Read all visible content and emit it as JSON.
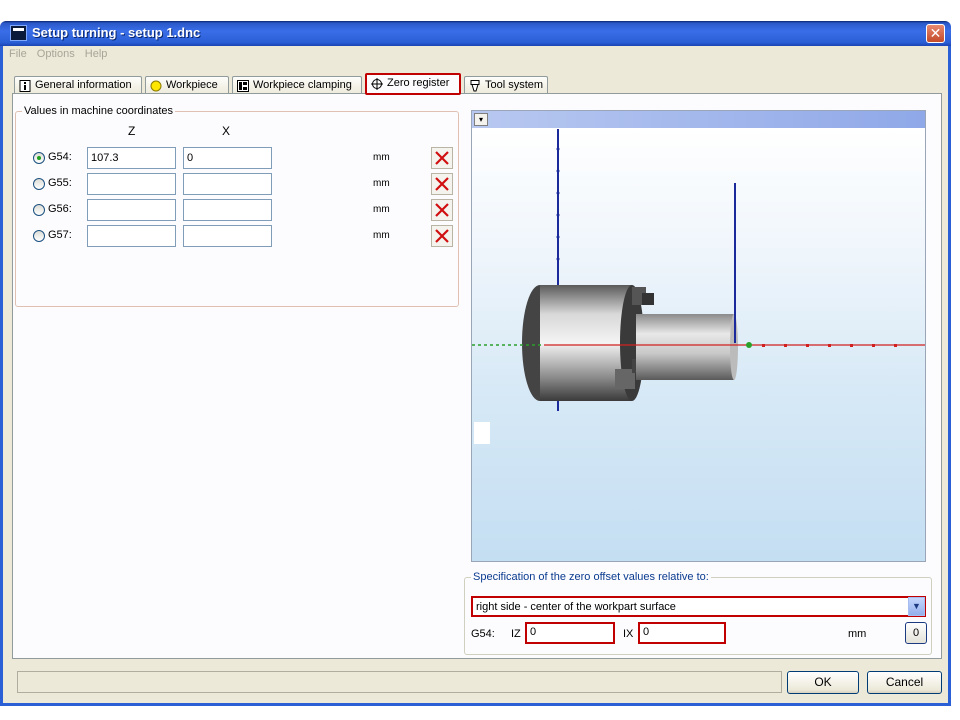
{
  "window": {
    "title": "Setup turning - setup 1.dnc",
    "close_glyph": "✕"
  },
  "menu": {
    "items": [
      "File",
      "Options",
      "Help"
    ]
  },
  "tabs": [
    {
      "label": "General information",
      "icon": "info-icon",
      "active": false
    },
    {
      "label": "Workpiece",
      "icon": "workpiece-circle-icon",
      "active": false
    },
    {
      "label": "Workpiece clamping",
      "icon": "clamping-icon",
      "active": false
    },
    {
      "label": "Zero register",
      "icon": "crosshair-icon",
      "active": true
    },
    {
      "label": "Tool system",
      "icon": "tool-holder-icon",
      "active": false
    }
  ],
  "coords": {
    "group_label": "Values in machine coordinates",
    "col_z": "Z",
    "col_x": "X",
    "unit": "mm",
    "rows": [
      {
        "label": "G54:",
        "z": "107.3",
        "x": "0",
        "selected": true
      },
      {
        "label": "G55:",
        "z": "",
        "x": "",
        "selected": false
      },
      {
        "label": "G56:",
        "z": "",
        "x": "",
        "selected": false
      },
      {
        "label": "G57:",
        "z": "",
        "x": "",
        "selected": false
      }
    ]
  },
  "view": {
    "dropdown_glyph": "▾"
  },
  "spec": {
    "label": "Specification of the zero offset values relative to:",
    "selected": "right side - center of the workpart surface",
    "g54_label": "G54:",
    "iz_label": "IZ",
    "iz_value": "0",
    "ix_label": "IX",
    "ix_value": "0",
    "unit": "mm",
    "zero_button": "0"
  },
  "buttons": {
    "ok": "OK",
    "cancel": "Cancel"
  },
  "colors": {
    "accent_red": "#c00000",
    "titlebar_blue": "#2a5fd6",
    "dialog_bg": "#ece9d8"
  }
}
